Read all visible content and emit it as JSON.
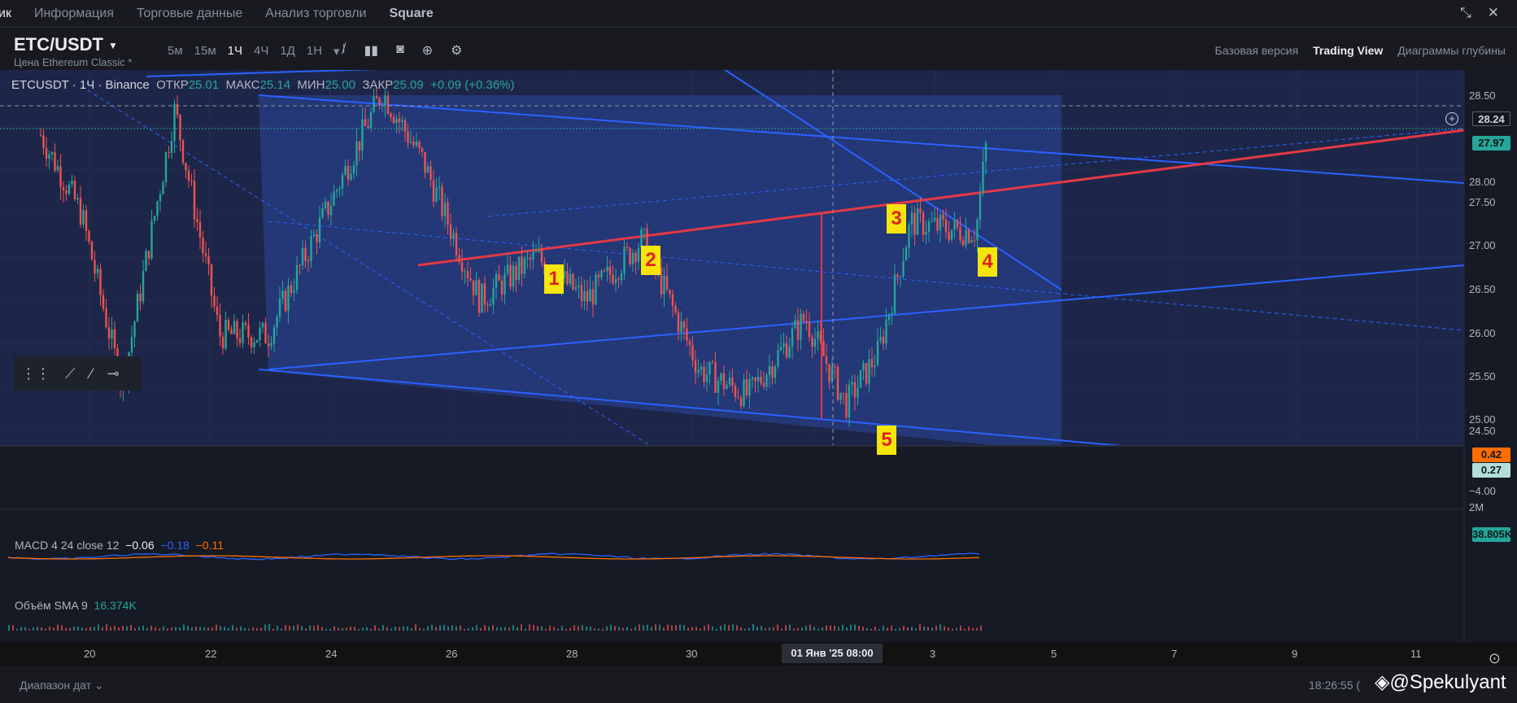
{
  "nav": {
    "tabs": [
      "ик",
      "Информация",
      "Торговые данные",
      "Анализ торговли",
      "Square"
    ],
    "icons": [
      "collapse-icon",
      "close-icon"
    ]
  },
  "header": {
    "symbol": "ETC/USDT",
    "subtitle": "Цена Ethereum Classic *",
    "intervals": [
      "5м",
      "15м",
      "1Ч",
      "4Ч",
      "1Д",
      "1Н"
    ],
    "active_interval": "1Ч",
    "views": [
      "Базовая версия",
      "Trading View",
      "Диаграммы глубины"
    ],
    "active_view": "Trading View"
  },
  "legend": {
    "symbol": "ETCUSDT · 1Ч · Binance",
    "open_label": "ОТКР",
    "open": "25.01",
    "high_label": "МАКС",
    "high": "25.14",
    "low_label": "МИН",
    "low": "25.00",
    "close_label": "ЗАКР",
    "close": "25.09",
    "change": "+0.09 (+0.36%)"
  },
  "price_axis": {
    "ticks": [
      "28.50",
      "28.00",
      "27.50",
      "27.00",
      "26.50",
      "26.00",
      "25.50",
      "25.00",
      "24.50"
    ],
    "crosshair_price": "28.24",
    "last_price": "27.97"
  },
  "macd": {
    "label": "MACD 4 24 close 12",
    "v1": "−0.06",
    "v2": "−0.18",
    "v3": "−0.11",
    "tag_high": "0.42",
    "tag_low": "0.27",
    "tick": "−4.00"
  },
  "volume": {
    "label": "Объём SMA 9",
    "value": "16.374K",
    "tick": "2M",
    "tag": "38.805K"
  },
  "time_axis": {
    "ticks": [
      "20",
      "22",
      "24",
      "26",
      "28",
      "30",
      "3",
      "5",
      "7",
      "9",
      "11"
    ],
    "crosshair": "01 Янв '25   08:00"
  },
  "waves": [
    "1",
    "2",
    "3",
    "4",
    "5"
  ],
  "footer": {
    "range": "Диапазон дат",
    "time": "18:26:55 (",
    "watermark": "@Spekulyant"
  },
  "colors": {
    "up": "#26a69a",
    "down": "#ef5350",
    "channel": "#2962ff",
    "trend": "#e53945",
    "wave_bg": "#f5e50a"
  },
  "chart_data": {
    "type": "candlestick",
    "pair": "ETCUSDT",
    "interval": "1H",
    "ylim": [
      24.25,
      28.7
    ],
    "key_prices": [
      {
        "label": "crosshair",
        "value": 28.24
      },
      {
        "label": "last",
        "value": 27.97
      }
    ],
    "wave_points": [
      {
        "wave": "1",
        "price": 26.6
      },
      {
        "wave": "2",
        "price": 26.75
      },
      {
        "wave": "3",
        "price": 27.2
      },
      {
        "wave": "4",
        "price": 26.75
      },
      {
        "wave": "5",
        "price": 24.7
      }
    ]
  }
}
